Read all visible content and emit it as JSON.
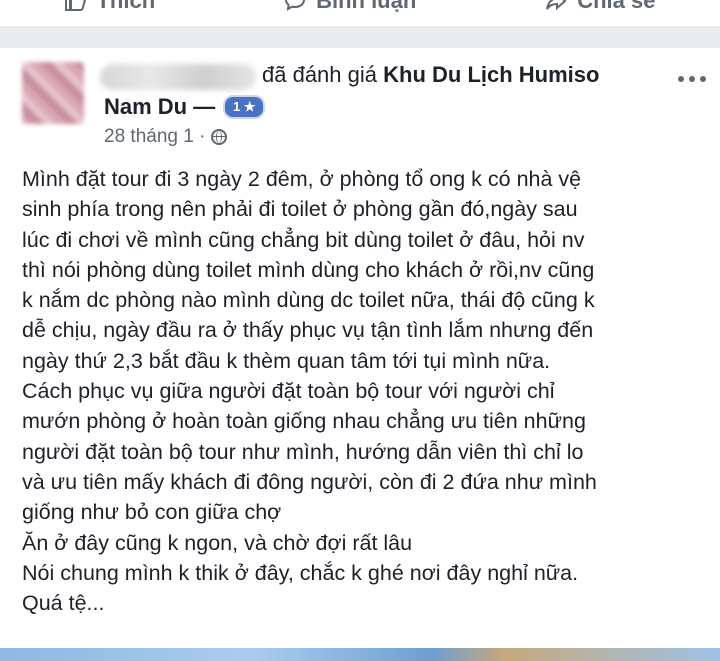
{
  "top_actions": {
    "like_label": "Thích",
    "comment_label": "Bình luận",
    "share_label": "Chia sẻ"
  },
  "post": {
    "action_text": "đã đánh giá",
    "place_line1": "Khu Du Lịch Humiso",
    "place_line2": "Nam Du —",
    "rating": "1 ★",
    "date": "28 tháng 1 ·",
    "body_lines": [
      "Mình đặt tour đi 3 ngày 2 đêm, ở phòng tổ ong k có nhà vệ",
      "sinh phía trong nên phải đi toilet ở phòng gần đó,ngày sau",
      "lúc đi chơi về mình cũng chẳng bit dùng toilet ở đâu, hỏi nv",
      "thì nói phòng dùng toilet mình dùng cho khách ở rồi,nv cũng",
      "k nắm dc phòng nào mình dùng dc toilet nữa, thái độ cũng k",
      "dễ chịu, ngày đầu ra ở thấy phục vụ tận tình lắm nhưng đến",
      "ngày thứ 2,3 bắt đầu k thèm quan tâm tới tụi mình nữa.",
      "Cách phục vụ giữa người đặt toàn bộ tour với người chỉ",
      "mướn phòng ở hoàn toàn giống nhau chẳng ưu tiên những",
      "người đặt toàn bộ tour như mình, hướng dẫn viên thì chỉ lo",
      "và ưu tiên mấy khách đi đông người, còn đi 2 đứa như mình",
      "giống như bỏ con giữa chợ",
      "Ăn ở đây cũng k ngon, và chờ đợi rất lâu",
      "Nói chung mình k thik ở đây, chắc k ghé nơi đây nghỉ nữa.",
      "Quá tệ..."
    ]
  },
  "colors": {
    "text": "#1d2129",
    "meta": "#606770",
    "badge": "#4a72c3",
    "band": "#e9ebee"
  }
}
